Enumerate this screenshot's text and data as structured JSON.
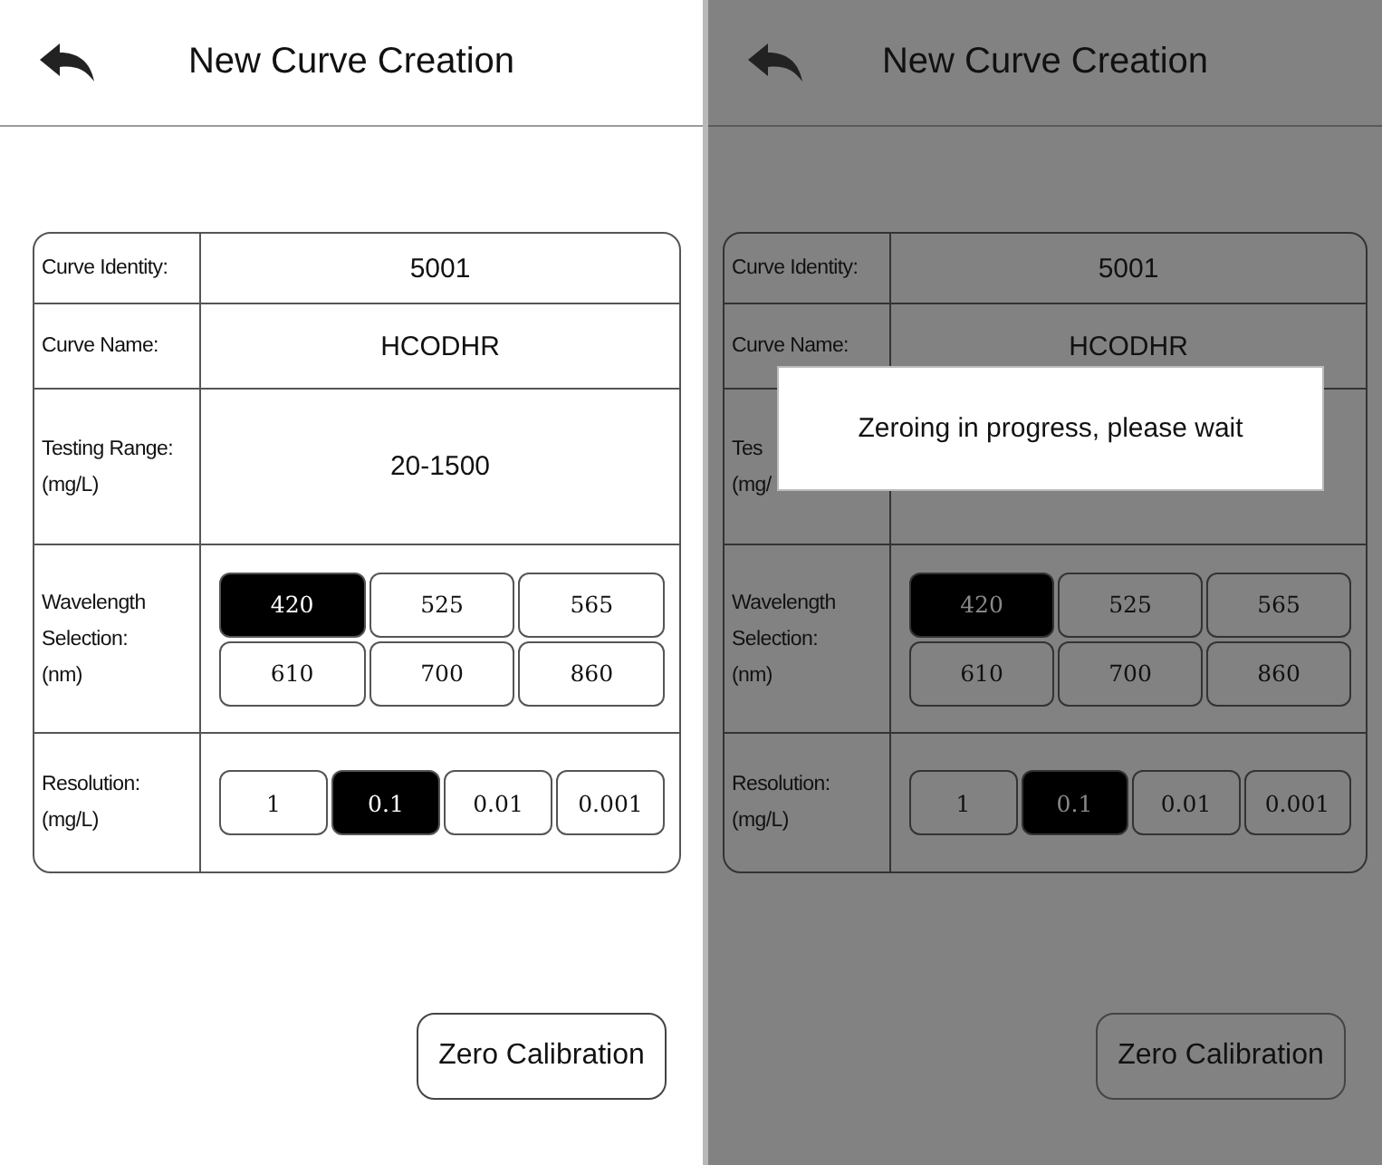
{
  "screens": [
    {
      "dimmed": false,
      "title": "New Curve Creation",
      "rows": [
        {
          "kind": "text",
          "label": "Curve Identity:",
          "value": "5001"
        },
        {
          "kind": "text",
          "label": "Curve Name:",
          "value": "HCODHR"
        },
        {
          "kind": "text",
          "label": "Testing Range:\n(mg/L)",
          "value": "20-1500"
        },
        {
          "kind": "options",
          "label": "Wavelength\nSelection:\n(nm)",
          "options": [
            {
              "label": "420",
              "selected": true
            },
            {
              "label": "525",
              "selected": false
            },
            {
              "label": "565",
              "selected": false
            },
            {
              "label": "610",
              "selected": false
            },
            {
              "label": "700",
              "selected": false
            },
            {
              "label": "860",
              "selected": false
            }
          ]
        },
        {
          "kind": "options",
          "label": "Resolution:\n(mg/L)",
          "options": [
            {
              "label": "1",
              "selected": false
            },
            {
              "label": "0.1",
              "selected": true
            },
            {
              "label": "0.01",
              "selected": false
            },
            {
              "label": "0.001",
              "selected": false
            }
          ]
        }
      ],
      "button": "Zero Calibration"
    },
    {
      "dimmed": true,
      "title": "New Curve Creation",
      "rows": [
        {
          "kind": "text",
          "label": "Curve Identity:",
          "value": "5001"
        },
        {
          "kind": "text",
          "label": "Curve Name:",
          "value": "HCODHR"
        },
        {
          "kind": "text",
          "label": "Tes\n(mg/"
        },
        {
          "kind": "options",
          "label": "Wavelength\nSelection:\n(nm)",
          "options": [
            {
              "label": "420",
              "selected": true
            },
            {
              "label": "525",
              "selected": false
            },
            {
              "label": "565",
              "selected": false
            },
            {
              "label": "610",
              "selected": false
            },
            {
              "label": "700",
              "selected": false
            },
            {
              "label": "860",
              "selected": false
            }
          ]
        },
        {
          "kind": "options",
          "label": "Resolution:\n(mg/L)",
          "options": [
            {
              "label": "1",
              "selected": false
            },
            {
              "label": "0.1",
              "selected": true
            },
            {
              "label": "0.01",
              "selected": false
            },
            {
              "label": "0.001",
              "selected": false
            }
          ]
        }
      ],
      "button": "Zero Calibration",
      "dialog": "Zeroing in progress, please wait"
    }
  ]
}
